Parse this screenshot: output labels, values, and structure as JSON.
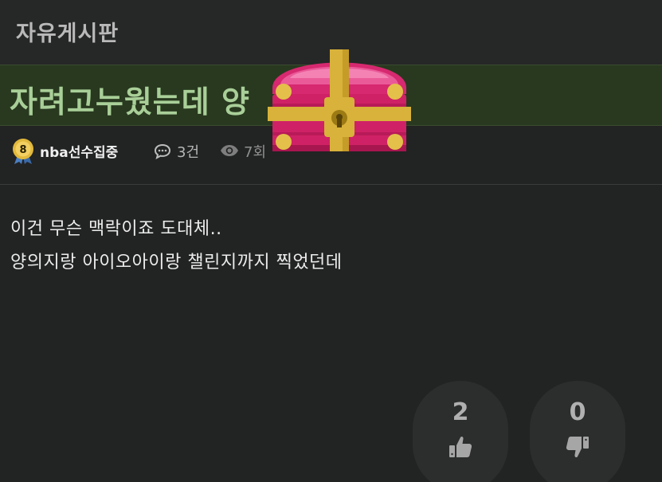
{
  "board": {
    "title": "자유게시판"
  },
  "post": {
    "title": "자려고누웠는데 양",
    "author": "nba선수집중",
    "level": "8",
    "comments": "3건",
    "views": "7회",
    "body_lines": [
      "이건 무슨 맥락이죠 도대체..",
      "양의지랑 아이오아이랑 챌린지까지 찍었던데"
    ]
  },
  "votes": {
    "up": "2",
    "down": "0"
  },
  "overlay": {
    "icon": "treasure-chest-icon"
  },
  "colors": {
    "background": "#222323",
    "title_band": "#28391f",
    "title_text": "#a9cf98",
    "chest_pink": "#d6296f",
    "chest_gold": "#d8b23a"
  }
}
